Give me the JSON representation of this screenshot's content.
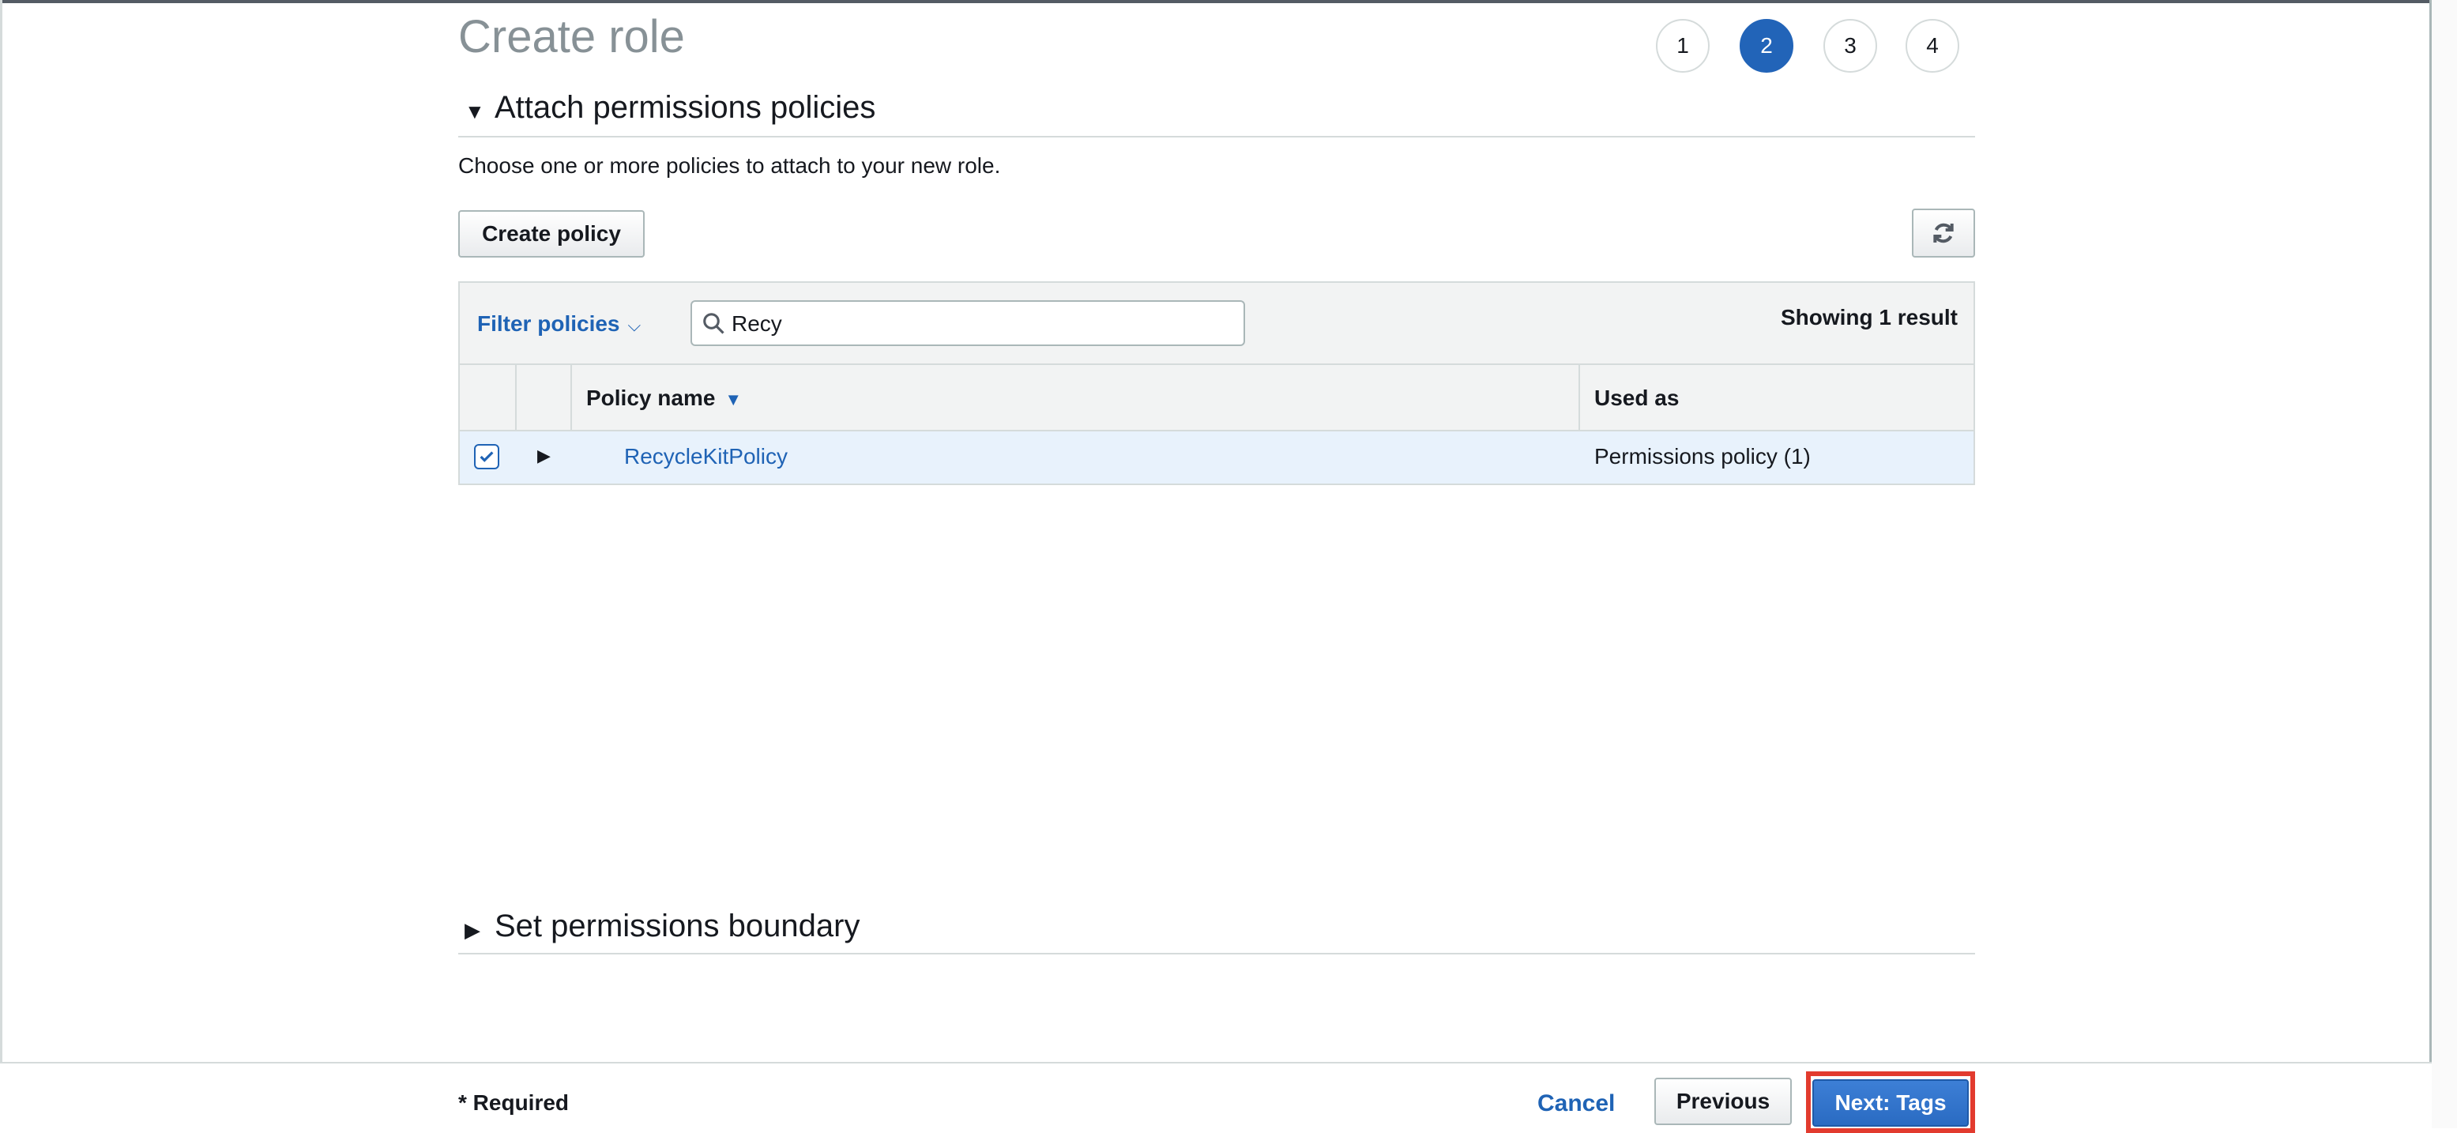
{
  "page": {
    "title": "Create role"
  },
  "steps": [
    "1",
    "2",
    "3",
    "4"
  ],
  "active_step": "2",
  "sections": {
    "attach": {
      "label": "Attach permissions policies",
      "expanded": true
    },
    "boundary": {
      "label": "Set permissions boundary",
      "expanded": false
    }
  },
  "description": "Choose one or more policies to attach to your new role.",
  "buttons": {
    "create_policy": "Create policy",
    "refresh_icon": "refresh-icon"
  },
  "table": {
    "filter_label": "Filter policies",
    "search_value": "Recy",
    "result_count": "Showing 1 result",
    "columns": {
      "policy_name": "Policy name",
      "used_as": "Used as"
    },
    "rows": [
      {
        "checked": true,
        "policy_name": "RecycleKitPolicy",
        "used_as": "Permissions policy (1)"
      }
    ]
  },
  "footer": {
    "required_note": "* Required",
    "cancel": "Cancel",
    "previous": "Previous",
    "next": "Next: Tags"
  },
  "colors": {
    "accent": "#2264b8",
    "link": "#1f63b5",
    "highlight_box": "#e23b2e",
    "row_selected": "#e8f2fc"
  }
}
